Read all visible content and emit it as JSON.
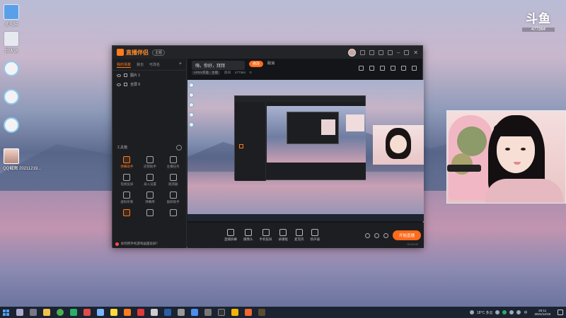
{
  "desktop": {
    "icons": [
      {
        "label": "此电脑",
        "icon": "computer-icon"
      },
      {
        "label": "回收站",
        "icon": "recycle-bin-icon"
      },
      {
        "label": "",
        "icon": "chat-app-icon"
      },
      {
        "label": "",
        "icon": "chat-app-icon"
      },
      {
        "label": "",
        "icon": "chat-app-icon"
      },
      {
        "label": "QQ截图 20211219...",
        "icon": "screenshot-file-icon"
      }
    ]
  },
  "watermark": {
    "brand": "斗鱼",
    "room": "477364"
  },
  "app": {
    "title": "直播伴侣",
    "badge": "主题",
    "sidebar": {
      "tabs": [
        "我的场景",
        "我也",
        "可改名"
      ],
      "scenes": [
        {
          "label": "图片 1"
        },
        {
          "label": "全屏 6"
        }
      ],
      "toolbox_label": "工具箱",
      "tools": [
        {
          "label": "弹幕助手",
          "hot": true
        },
        {
          "label": "房管助手",
          "hot": false
        },
        {
          "label": "主播任务",
          "hot": false
        },
        {
          "label": "电视投屏",
          "hot": false
        },
        {
          "label": "录入设置",
          "hot": false
        },
        {
          "label": "观测器",
          "hot": false
        },
        {
          "label": "虚拟形象",
          "hot": false
        },
        {
          "label": "弹幕库",
          "hot": false
        },
        {
          "label": "副屏助手",
          "hot": false
        },
        {
          "label": "",
          "hot": false
        },
        {
          "label": "",
          "hot": false
        },
        {
          "label": "",
          "hot": false
        }
      ],
      "notice": "如何把手机游戏画面投屏？"
    },
    "main": {
      "room_title": "嗨，你好，拜拜",
      "edit_label": "修改",
      "cancel_label": "取消",
      "category": "APEX英雄 · 主播",
      "room_label": "房间",
      "room_id": "477364",
      "heat": "0"
    },
    "controls": {
      "buttons": [
        "直播屏幕",
        "摄像头",
        "手机投屏",
        "录播框",
        "麦克风",
        "扬声器"
      ],
      "go_live": "开始直播"
    },
    "status": {
      "bitrate": "",
      "fps": "",
      "cpu": "",
      "time": "00:00:00"
    }
  },
  "taskbar": {
    "weather": "18°C 多云",
    "time": "20:11",
    "date": "2021/12/19",
    "ime": "中"
  }
}
